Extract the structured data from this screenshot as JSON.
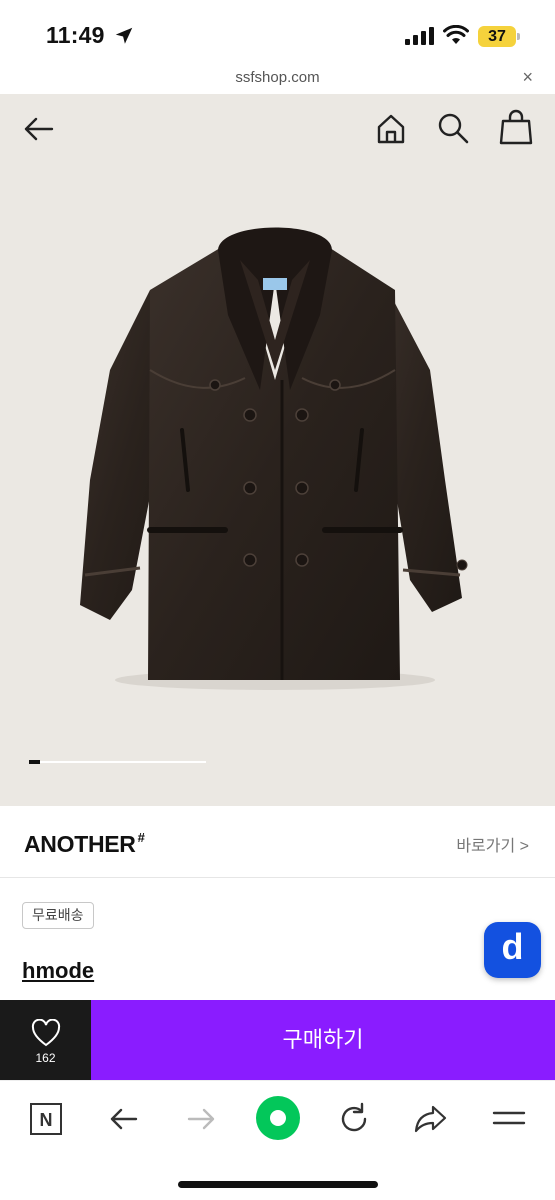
{
  "status_bar": {
    "time": "11:49",
    "battery": "37",
    "battery_color": "#f5d23c"
  },
  "browser": {
    "url": "ssfshop.com",
    "close_label": "×"
  },
  "gallery": {
    "image_index": 1,
    "progress_fraction": 0.06
  },
  "brand": {
    "name": "ANOTHER",
    "name_mark": "#",
    "link_label": "바로가기 >"
  },
  "product": {
    "badge": "무료배송",
    "seller": "hmode"
  },
  "floating_button": {
    "label": "d",
    "color": "#1351e0"
  },
  "buy_bar": {
    "like_count": "162",
    "buy_label": "구매하기",
    "buy_color": "#8a1cff"
  },
  "toolbar": {
    "n_label": "N",
    "accent_color": "#03c75a"
  }
}
